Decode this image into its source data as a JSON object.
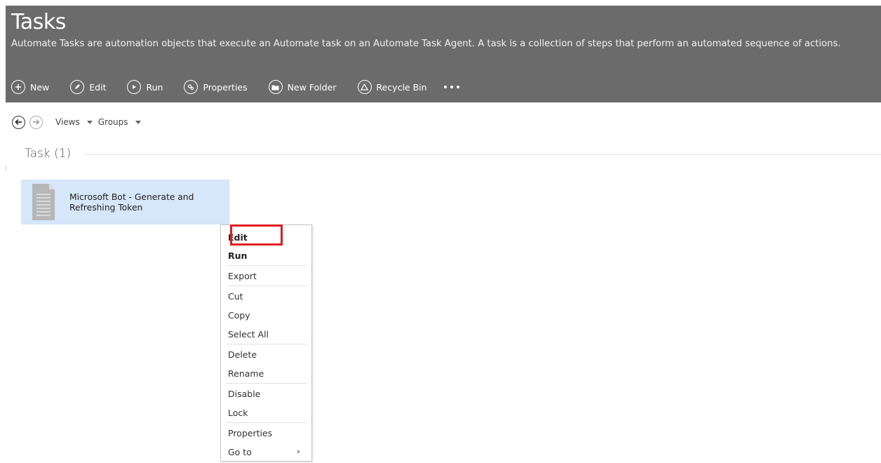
{
  "header": {
    "title": "Tasks",
    "subtitle": "Automate Tasks are automation objects that execute an Automate task on an Automate Task Agent. A task is a collection of steps that perform an automated sequence of actions."
  },
  "toolbar": {
    "new_label": "New",
    "edit_label": "Edit",
    "run_label": "Run",
    "properties_label": "Properties",
    "new_folder_label": "New Folder",
    "recycle_bin_label": "Recycle Bin"
  },
  "nav": {
    "views_label": "Views",
    "groups_label": "Groups"
  },
  "group": {
    "title": "Task (1)"
  },
  "tile": {
    "line1": "Microsoft Bot - Generate and",
    "line2": "Refreshing Token"
  },
  "context_menu": {
    "items": [
      "Edit",
      "Run",
      "Export",
      "Cut",
      "Copy",
      "Select All",
      "Delete",
      "Rename",
      "Disable",
      "Lock",
      "Properties",
      "Go to"
    ]
  },
  "colors": {
    "header_bg": "#6b6b6b",
    "tile_selected": "#d5e7f9",
    "highlight_border": "#e21b23"
  }
}
